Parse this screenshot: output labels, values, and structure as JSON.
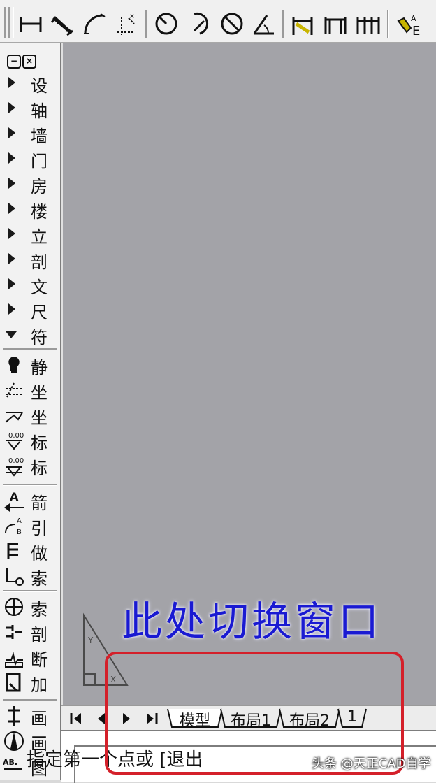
{
  "toolbar": {
    "buttons": [
      "dimension-linear-icon",
      "dimension-aligned-icon",
      "dimension-arc-icon",
      "dimension-coordinate-icon",
      "dimension-radius-icon",
      "dimension-arc-radius-icon",
      "dimension-diameter-icon",
      "dimension-angle-icon",
      "dimension-wall-icon",
      "dimension-door-window-icon",
      "dimension-chain-icon",
      "text-style-icon"
    ]
  },
  "left_panel": {
    "menu_items": [
      {
        "label": "设",
        "expanded": false
      },
      {
        "label": "轴",
        "expanded": false
      },
      {
        "label": "墙",
        "expanded": false
      },
      {
        "label": "门",
        "expanded": false
      },
      {
        "label": "房",
        "expanded": false
      },
      {
        "label": "楼",
        "expanded": false
      },
      {
        "label": "立",
        "expanded": false
      },
      {
        "label": "剖",
        "expanded": false
      },
      {
        "label": "文",
        "expanded": false
      },
      {
        "label": "尺",
        "expanded": false
      },
      {
        "label": "符",
        "expanded": true
      }
    ],
    "tools_group1": [
      {
        "label": "静",
        "icon": "bulb-icon"
      },
      {
        "label": "坐",
        "icon": "coordinate-icon"
      },
      {
        "label": "坐",
        "icon": "coordinate-check-icon"
      },
      {
        "label": "标",
        "icon": "elevation-mark-icon"
      },
      {
        "label": "标",
        "icon": "elevation-check-icon"
      }
    ],
    "tools_group2": [
      {
        "label": "箭",
        "icon": "arrow-text-icon"
      },
      {
        "label": "引",
        "icon": "leader-icon"
      },
      {
        "label": "做",
        "icon": "finish-table-icon"
      },
      {
        "label": "索",
        "icon": "index-point-icon"
      }
    ],
    "tools_group3": [
      {
        "label": "索",
        "icon": "index-symbol-icon"
      },
      {
        "label": "剖",
        "icon": "section-symbol-icon"
      },
      {
        "label": "断",
        "icon": "break-line-icon"
      },
      {
        "label": "加",
        "icon": "add-break-icon"
      }
    ],
    "tools_group4": [
      {
        "label": "画",
        "icon": "draw-axis-icon"
      },
      {
        "label": "画",
        "icon": "north-arrow-icon"
      },
      {
        "label": "图",
        "icon": "drawing-name-icon"
      }
    ]
  },
  "canvas": {
    "headline": "此处切换窗口"
  },
  "tabs": {
    "nav_buttons": [
      "first-tab-icon",
      "prev-tab-icon",
      "next-tab-icon",
      "last-tab-icon"
    ],
    "items": [
      {
        "label": "模型",
        "active": true
      },
      {
        "label": "布局1",
        "active": false
      },
      {
        "label": "布局2",
        "active": false
      },
      {
        "label": "1",
        "active": false
      }
    ]
  },
  "command_line": {
    "text": "指定第一个点或 [退出"
  },
  "watermark": {
    "text": "头条 @天正CAD自学"
  },
  "colors": {
    "canvas_bg": "#a3a3a8",
    "headline": "#1a1ad2",
    "highlight": "#d4202a"
  }
}
